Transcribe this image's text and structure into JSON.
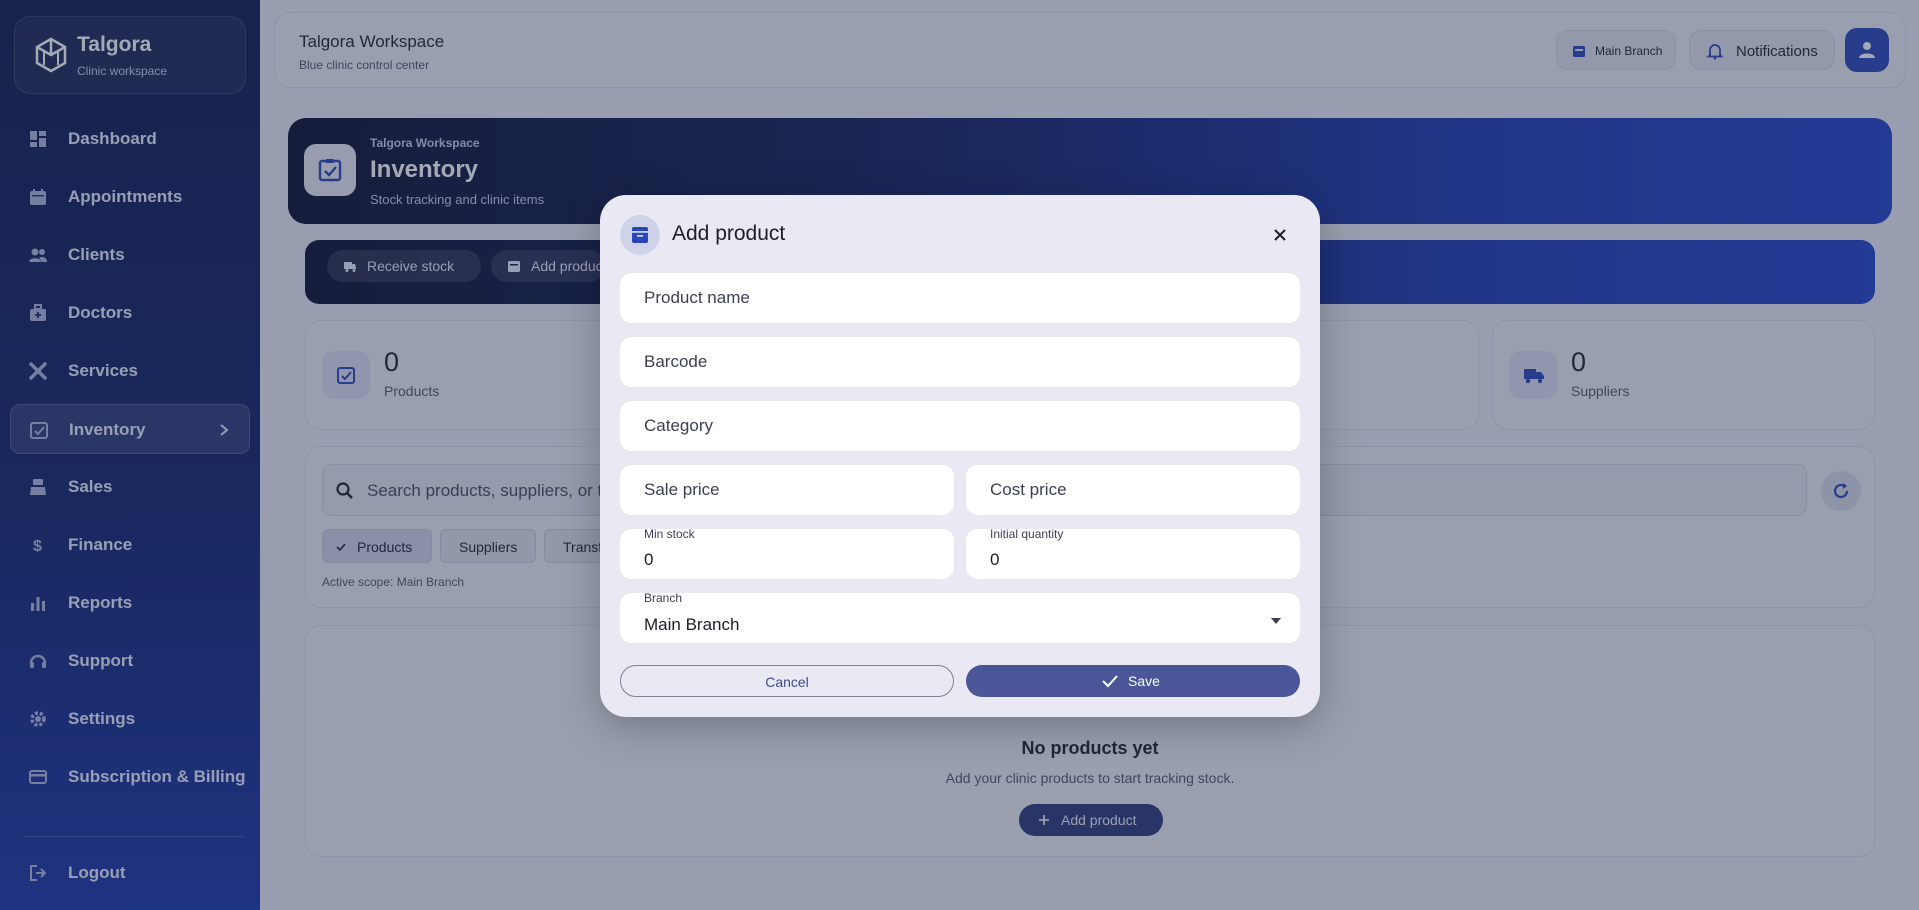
{
  "brand": {
    "name": "Talgora",
    "subtitle": "Clinic workspace"
  },
  "sidebar": {
    "items": [
      {
        "label": "Dashboard",
        "icon": "dashboard-icon"
      },
      {
        "label": "Appointments",
        "icon": "calendar-icon"
      },
      {
        "label": "Clients",
        "icon": "people-icon"
      },
      {
        "label": "Doctors",
        "icon": "medical-bag-icon"
      },
      {
        "label": "Services",
        "icon": "tools-icon"
      },
      {
        "label": "Inventory",
        "icon": "inventory-icon",
        "active": true
      },
      {
        "label": "Sales",
        "icon": "register-icon"
      },
      {
        "label": "Finance",
        "icon": "dollar-icon"
      },
      {
        "label": "Reports",
        "icon": "bar-chart-icon"
      },
      {
        "label": "Support",
        "icon": "headset-icon"
      },
      {
        "label": "Settings",
        "icon": "gear-icon"
      },
      {
        "label": "Subscription & Billing",
        "icon": "credit-card-icon"
      }
    ],
    "logout_label": "Logout"
  },
  "header": {
    "title": "Talgora Workspace",
    "subtitle": "Blue clinic control center",
    "branch_label": "Main Branch",
    "notifications_label": "Notifications"
  },
  "hero": {
    "kicker": "Talgora Workspace",
    "title": "Inventory",
    "subtitle": "Stock tracking and clinic items"
  },
  "actions": {
    "receive_stock": "Receive stock",
    "add_product": "Add produc"
  },
  "stats": [
    {
      "value": "0",
      "label": "Products"
    },
    {
      "value": "0",
      "label": "Suppliers"
    }
  ],
  "search": {
    "placeholder": "Search products, suppliers, or t",
    "chips": [
      "Products",
      "Suppliers",
      "Transf"
    ],
    "active_scope": "Active scope: Main Branch"
  },
  "empty": {
    "title": "No products yet",
    "subtitle": "Add your clinic products to start tracking stock.",
    "button": "Add product"
  },
  "modal": {
    "title": "Add product",
    "fields": {
      "product_name": "Product name",
      "barcode": "Barcode",
      "category": "Category",
      "sale_price": "Sale price",
      "cost_price": "Cost price",
      "min_stock_label": "Min stock",
      "min_stock_value": "0",
      "initial_quantity_label": "Initial quantity",
      "initial_quantity_value": "0",
      "branch_label": "Branch",
      "branch_value": "Main Branch"
    },
    "cancel_label": "Cancel",
    "save_label": "Save"
  },
  "colors": {
    "sidebar_top": "#0c1a4a",
    "sidebar_bottom": "#1836a6",
    "accent": "#2846b8",
    "save_button": "#4a5698"
  }
}
